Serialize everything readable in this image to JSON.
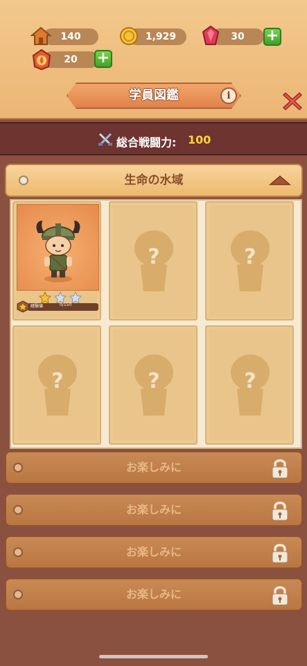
{
  "resources": {
    "home": {
      "icon": "house-icon",
      "value": "140"
    },
    "coins": {
      "icon": "coin-icon",
      "value": "1,929"
    },
    "gems": {
      "icon": "gem-icon",
      "value": "30"
    },
    "badge": {
      "icon": "fire-badge-icon",
      "value": "20"
    }
  },
  "header": {
    "title": "学員図鑑",
    "info_icon": "info-icon",
    "close_icon": "close-icon"
  },
  "power": {
    "icon": "crossed-swords-icon",
    "label": "総合戦闘力:",
    "value": "100"
  },
  "region": {
    "title": "生命の水域",
    "toggle_icon": "triangle-up-icon"
  },
  "cards": [
    {
      "unlocked": true,
      "name_icon": "viking-warrior-portrait",
      "stars_filled": 1,
      "stars_total": 3,
      "exp_label": "経験値",
      "exp_value": "0/150"
    },
    {
      "unlocked": false,
      "placeholder": "?"
    },
    {
      "unlocked": false,
      "placeholder": "?"
    },
    {
      "unlocked": false,
      "placeholder": "?"
    },
    {
      "unlocked": false,
      "placeholder": "?"
    },
    {
      "unlocked": false,
      "placeholder": "?"
    }
  ],
  "locked_regions": [
    {
      "label": "お楽しみに"
    },
    {
      "label": "お楽しみに"
    },
    {
      "label": "お楽しみに"
    },
    {
      "label": "お楽しみに"
    }
  ],
  "colors": {
    "background": "#8a5040",
    "header_bg": "#ebb674",
    "power_value": "#ffd23c",
    "plus_button": "#3ea22a",
    "close_x": "#e2584e"
  }
}
